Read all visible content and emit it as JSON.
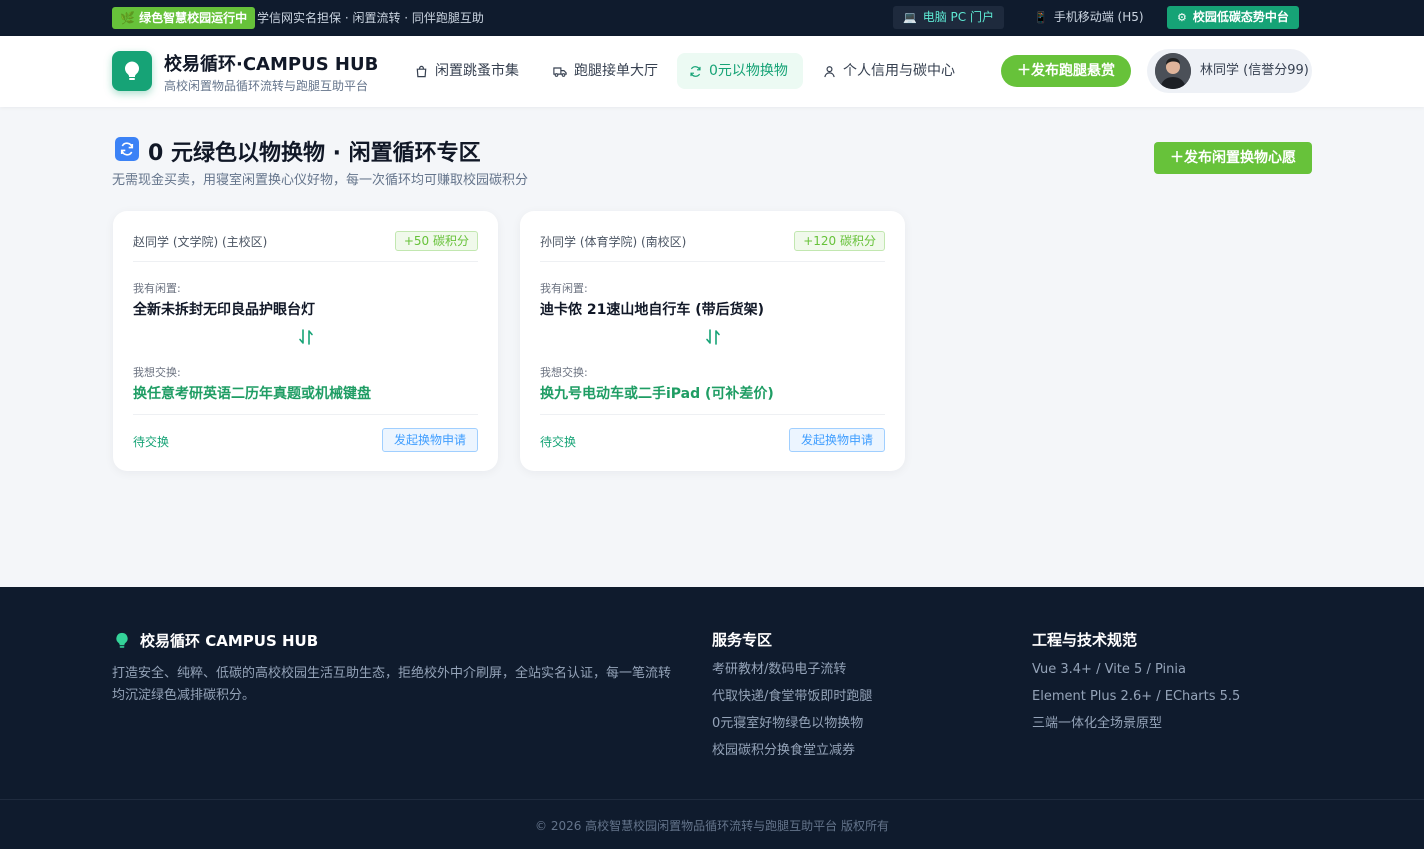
{
  "topbar": {
    "running_badge": "绿色智慧校园运行中",
    "tagline": "学信网实名担保 · 闲置流转 · 同伴跑腿互助",
    "pc_portal": "电脑 PC 门户",
    "mobile": "手机移动端 (H5)",
    "center": "校园低碳态势中台"
  },
  "header": {
    "brand_title": "校易循环·CAMPUS HUB",
    "brand_subtitle": "高校闲置物品循环流转与跑腿互助平台",
    "nav": [
      {
        "label": "闲置跳蚤市集",
        "icon": "shopping-bag-icon"
      },
      {
        "label": "跑腿接单大厅",
        "icon": "truck-icon"
      },
      {
        "label": "0元以物换物",
        "icon": "refresh-icon",
        "active": true
      },
      {
        "label": "个人信用与碳中心",
        "icon": "user-icon"
      }
    ],
    "post_errand_label": "＋发布跑腿悬赏",
    "user_name": "林同学 (信誉分99)"
  },
  "main": {
    "title": "0 元绿色以物换物 · 闲置循环专区",
    "subtitle": "无需现金买卖，用寝室闲置换心仪好物，每一次循环均可赚取校园碳积分",
    "post_wish_label": "＋发布闲置换物心愿",
    "cards": [
      {
        "owner": "赵同学 (文学院) (主校区)",
        "carbon": "+50 碳积分",
        "have_label": "我有闲置:",
        "have_item": "全新未拆封无印良品护眼台灯",
        "want_label": "我想交换:",
        "want_item": "换任意考研英语二历年真题或机械键盘",
        "status": "待交换",
        "apply_label": "发起换物申请"
      },
      {
        "owner": "孙同学 (体育学院) (南校区)",
        "carbon": "+120 碳积分",
        "have_label": "我有闲置:",
        "have_item": "迪卡侬 21速山地自行车 (带后货架)",
        "want_label": "我想交换:",
        "want_item": "换九号电动车或二手iPad (可补差价)",
        "status": "待交换",
        "apply_label": "发起换物申请"
      }
    ]
  },
  "footer": {
    "brand": "校易循环 CAMPUS HUB",
    "description": "打造安全、纯粹、低碳的高校校园生活互助生态，拒绝校外中介刷屏，全站实名认证，每一笔流转均沉淀绿色减排碳积分。",
    "services_title": "服务专区",
    "services": [
      "考研教材/数码电子流转",
      "代取快递/食堂带饭即时跑腿",
      "0元寝室好物绿色以物换物",
      "校园碳积分换食堂立减券"
    ],
    "tech_title": "工程与技术规范",
    "tech": [
      "Vue 3.4+ / Vite 5 / Pinia",
      "Element Plus 2.6+ / ECharts 5.5",
      "三端一体化全场景原型"
    ],
    "copyright": "© 2026 高校智慧校园闲置物品循环流转与跑腿互助平台 版权所有"
  },
  "colors": {
    "brand_green": "#16a376",
    "accent_green": "#67c23a",
    "dark_navy": "#0f1b2d",
    "link_blue": "#409eff"
  }
}
